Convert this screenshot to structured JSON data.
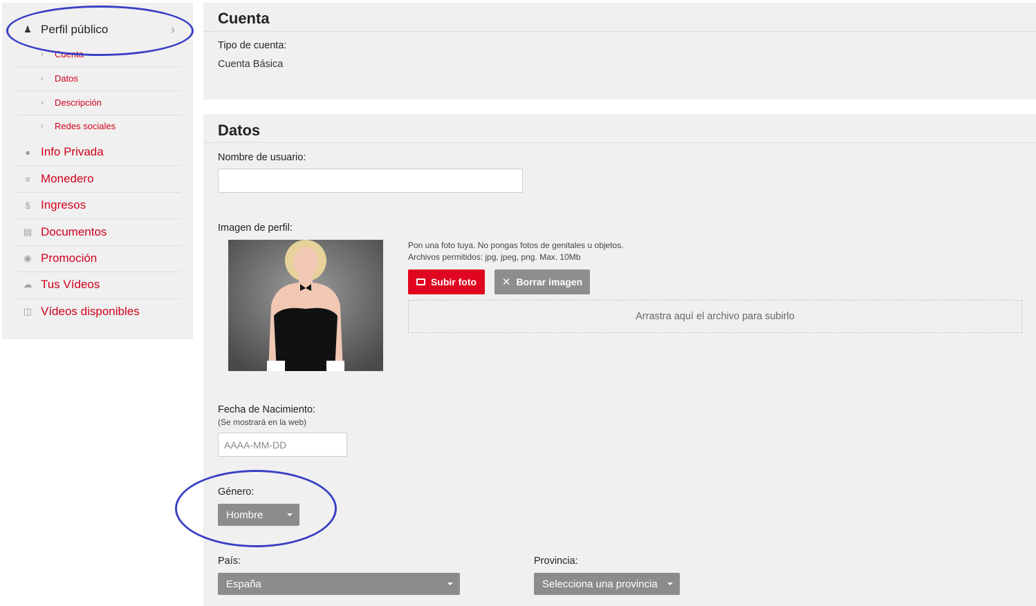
{
  "sidebar": {
    "active_item": "Perfil público",
    "sub_items": [
      "Cuenta",
      "Datos",
      "Descripción",
      "Redes sociales"
    ],
    "items": [
      {
        "label": "Info Privada",
        "icon": "user-icon"
      },
      {
        "label": "Monedero",
        "icon": "coins-icon"
      },
      {
        "label": "Ingresos",
        "icon": "dollar-icon"
      },
      {
        "label": "Documentos",
        "icon": "documents-icon"
      },
      {
        "label": "Promoción",
        "icon": "globe-icon"
      },
      {
        "label": "Tus Vídeos",
        "icon": "cloud-upload-icon"
      },
      {
        "label": "Vídeos disponibles",
        "icon": "film-icon"
      }
    ]
  },
  "cuenta": {
    "title": "Cuenta",
    "tipo_label": "Tipo de cuenta:",
    "tipo_value": "Cuenta Básica"
  },
  "datos": {
    "title": "Datos",
    "username_label": "Nombre de usuario:",
    "username_value": "",
    "image_label": "Imagen de perfil:",
    "image_hint_1": "Pon una foto tuya. No pongas fotos de genitales u objetos.",
    "image_hint_2": "Archivos permitidos: jpg, jpeg, png. Max. 10Mb",
    "upload_button": "Subir foto",
    "delete_button": "Borrar imagen",
    "dropzone_text": "Arrastra aquí el archivo para subirlo",
    "birth_label": "Fecha de Nacimiento:",
    "birth_note": "(Se mostrará en la web)",
    "birth_placeholder": "AAAA-MM-DD",
    "gender_label": "Género:",
    "gender_value": "Hombre",
    "country_label": "País:",
    "country_value": "España",
    "province_label": "Provincia:",
    "province_value": "Selecciona una provincia"
  },
  "colors": {
    "accent": "#d0021b",
    "button_red": "#e0061f",
    "button_grey": "#8e8e8e",
    "annotation": "#3a3fc4"
  }
}
